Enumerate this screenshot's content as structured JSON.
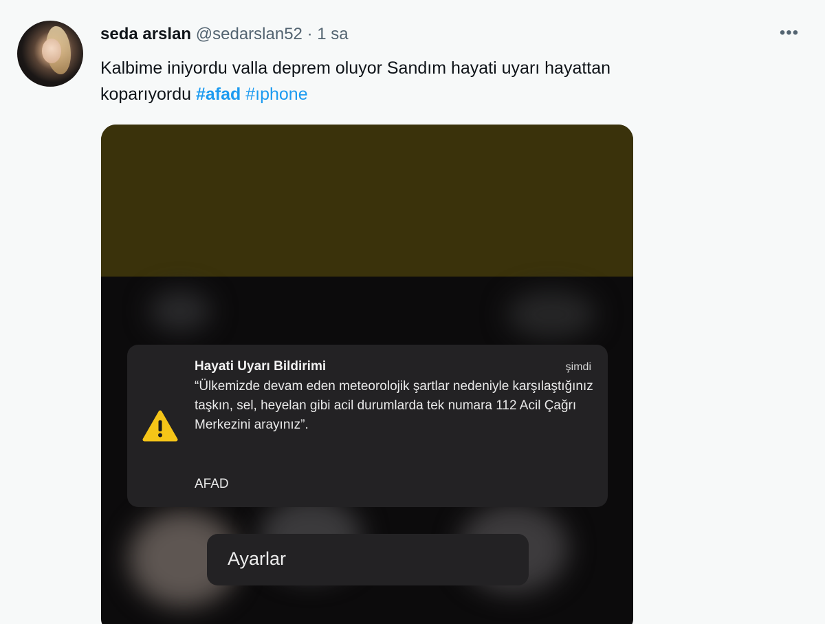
{
  "tweet": {
    "name": "seda arslan",
    "handle": "@sedarslan52",
    "separator": "·",
    "time": "1 sa",
    "more_icon": "more-horizontal-icon",
    "text_line1": "Kalbime iniyordu valla deprem oluyor   Sandım hayati uyarı hayattan",
    "text_line2": "koparıyordu ",
    "hashtag1": "#afad",
    "hashtag2": "#ıphone",
    "hashtag_color": "#1d9bf0"
  },
  "notification": {
    "title": "Hayati Uyarı Bildirimi",
    "time": "şimdi",
    "body": "“Ülkemizde devam eden meteorolojik şartlar nedeniyle karşılaştığınız taşkın, sel, heyelan gibi acil durumlarda  tek numara 112 Acil Çağrı Merkezini arayınız”.",
    "source": "AFAD",
    "icon": "warning-triangle-icon",
    "icon_color": "#f5c518"
  },
  "settings_button": {
    "label": "Ayarlar"
  }
}
